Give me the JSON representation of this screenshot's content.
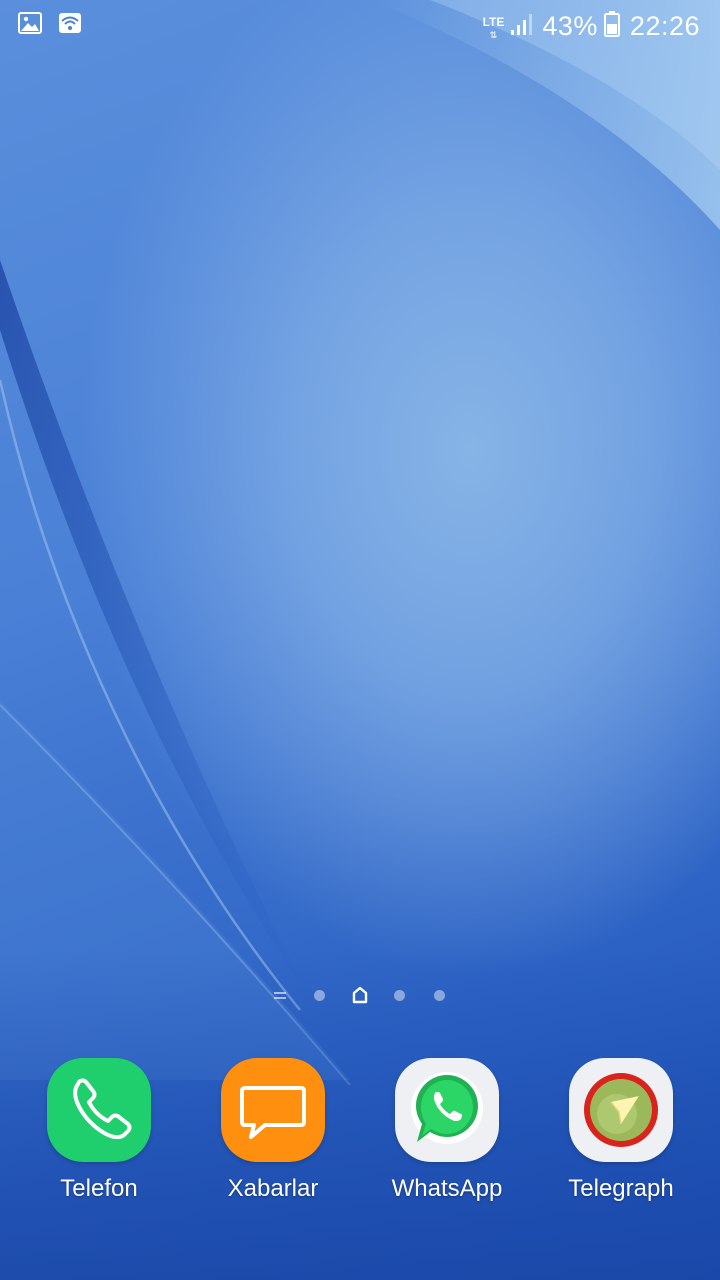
{
  "status_bar": {
    "network_type": "LTE",
    "battery_percent": "43%",
    "time": "22:26",
    "icons": [
      "gallery-notification-icon",
      "wifi-icon",
      "lte-icon",
      "signal-icon",
      "battery-icon"
    ]
  },
  "page_indicators": {
    "items": [
      "apps-list-indicator",
      "page-dot",
      "home-indicator",
      "page-dot",
      "page-dot"
    ],
    "active": "home-indicator"
  },
  "dock": {
    "apps": [
      {
        "label": "Telefon",
        "icon": "phone-icon",
        "color": "#1fcf6e"
      },
      {
        "label": "Xabarlar",
        "icon": "message-icon",
        "color": "#ff8f0f"
      },
      {
        "label": "WhatsApp",
        "icon": "whatsapp-icon",
        "color": "#25d366"
      },
      {
        "label": "Telegraph",
        "icon": "telegraph-icon",
        "color": "#d9241d"
      }
    ]
  },
  "colors": {
    "wallpaper_light": "#86b4e6",
    "wallpaper_dark": "#1c4fb4"
  }
}
